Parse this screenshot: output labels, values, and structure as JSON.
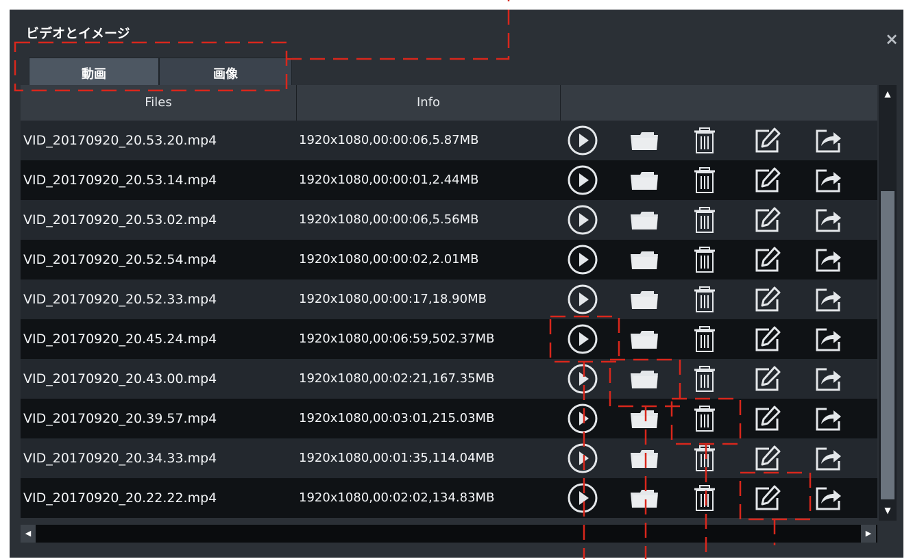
{
  "window": {
    "title": "ビデオとイメージ",
    "close_label": "×"
  },
  "tabs": [
    {
      "label": "動画",
      "active": true
    },
    {
      "label": "画像",
      "active": false
    }
  ],
  "table": {
    "headers": {
      "files": "Files",
      "info": "Info"
    },
    "rows": [
      {
        "file": "VID_20170920_20.53.20.mp4",
        "info": "1920x1080,00:00:06,5.87MB"
      },
      {
        "file": "VID_20170920_20.53.14.mp4",
        "info": "1920x1080,00:00:01,2.44MB"
      },
      {
        "file": "VID_20170920_20.53.02.mp4",
        "info": "1920x1080,00:00:06,5.56MB"
      },
      {
        "file": "VID_20170920_20.52.54.mp4",
        "info": "1920x1080,00:00:02,2.01MB"
      },
      {
        "file": "VID_20170920_20.52.33.mp4",
        "info": "1920x1080,00:00:17,18.90MB"
      },
      {
        "file": "VID_20170920_20.45.24.mp4",
        "info": "1920x1080,00:06:59,502.37MB"
      },
      {
        "file": "VID_20170920_20.43.00.mp4",
        "info": "1920x1080,00:02:21,167.35MB"
      },
      {
        "file": "VID_20170920_20.39.57.mp4",
        "info": "1920x1080,00:03:01,215.03MB"
      },
      {
        "file": "VID_20170920_20.34.33.mp4",
        "info": "1920x1080,00:01:35,114.04MB"
      },
      {
        "file": "VID_20170920_20.22.22.mp4",
        "info": "1920x1080,00:02:02,134.83MB"
      }
    ],
    "row_actions": [
      "play-icon",
      "folder-icon",
      "trash-icon",
      "edit-icon",
      "share-icon"
    ]
  },
  "colors": {
    "window_bg": "#2b3036",
    "row_odd": "#23282e",
    "row_even": "#0f1215",
    "icon": "#e4e7ea",
    "annotation": "#d9271c"
  }
}
